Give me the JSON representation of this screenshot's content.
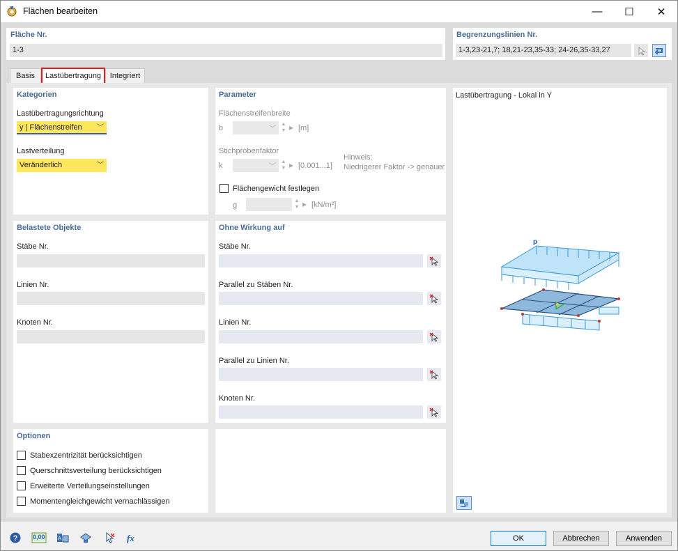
{
  "window": {
    "title": "Flächen bearbeiten",
    "minimize": "—",
    "maximize": "☐",
    "close": "✕"
  },
  "surface": {
    "label": "Fläche Nr.",
    "value": "1-3"
  },
  "boundary": {
    "label": "Begrenzungslinien Nr.",
    "value": "1-3,23-21,7; 18,21-23,35-33; 24-26,35-33,27"
  },
  "tabs": [
    "Basis",
    "Lastübertragung",
    "Integriert"
  ],
  "kategorien": {
    "header": "Kategorien",
    "direction_label": "Lastübertragungsrichtung",
    "direction_value": "y | Flächenstreifen",
    "distribution_label": "Lastverteilung",
    "distribution_value": "Veränderlich"
  },
  "parameter": {
    "header": "Parameter",
    "strip_width_label": "Flächenstreifenbreite",
    "b_symbol": "b",
    "b_unit": "[m]",
    "sample_factor_label": "Stichprobenfaktor",
    "k_symbol": "k",
    "k_unit": "[0.001...1]",
    "hint_title": "Hinweis:",
    "hint_text": "Niedrigerer Faktor -> genauer",
    "weight_check_label": "Flächengewicht festlegen",
    "g_symbol": "g",
    "g_unit": "[kN/m²]"
  },
  "belastete": {
    "header": "Belastete Objekte",
    "members_label": "Stäbe Nr.",
    "lines_label": "Linien Nr.",
    "nodes_label": "Knoten Nr."
  },
  "ohne": {
    "header": "Ohne Wirkung auf",
    "members_label": "Stäbe Nr.",
    "parallel_members_label": "Parallel zu Stäben Nr.",
    "lines_label": "Linien Nr.",
    "parallel_lines_label": "Parallel zu Linien Nr.",
    "nodes_label": "Knoten Nr."
  },
  "optionen": {
    "header": "Optionen",
    "items": [
      "Stabexzentrizität berücksichtigen",
      "Querschnittsverteilung berücksichtigen",
      "Erweiterte Verteilungseinstellungen",
      "Momentengleichgewicht vernachlässigen"
    ]
  },
  "preview": {
    "title": "Lastübertragung - Lokal in Y",
    "load_symbol": "p"
  },
  "buttons": {
    "ok": "OK",
    "cancel": "Abbrechen",
    "apply": "Anwenden"
  },
  "footer_tools": {
    "zero_label": "0,00"
  },
  "colors": {
    "accent": "#4a6a96",
    "highlight": "#fde55c",
    "load_blue": "#3a9ad9",
    "tab_highlight": "#e02020"
  }
}
